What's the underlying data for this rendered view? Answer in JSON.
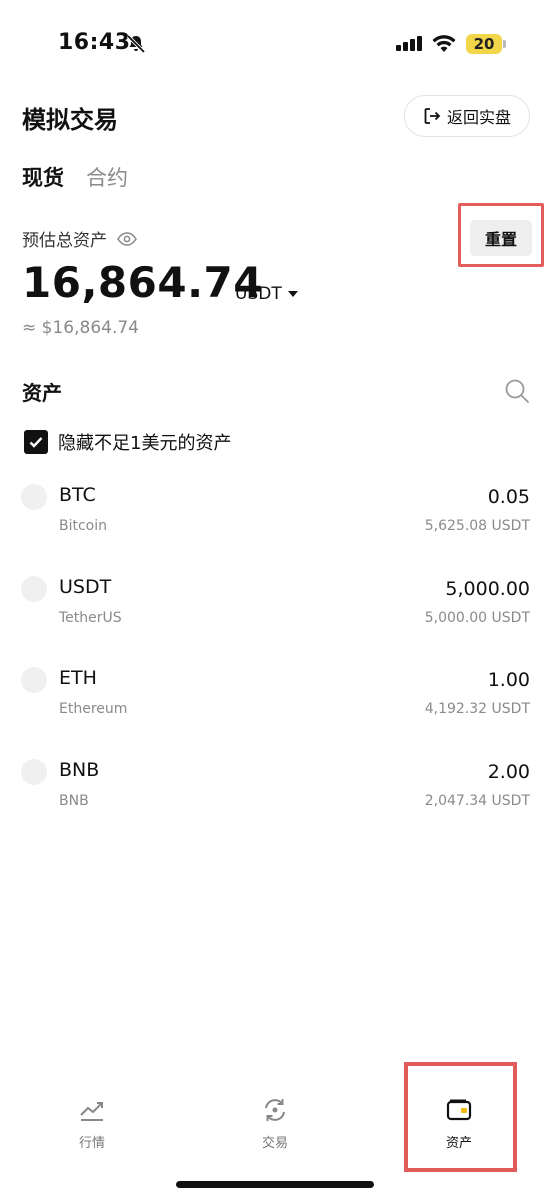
{
  "status_bar": {
    "time": "16:43",
    "battery": "20"
  },
  "header": {
    "title": "模拟交易",
    "back_button": "返回实盘"
  },
  "tabs": [
    {
      "label": "现货",
      "active": true
    },
    {
      "label": "合约",
      "active": false
    }
  ],
  "summary": {
    "label": "预估总资产",
    "reset_label": "重置",
    "total": "16,864.74",
    "unit": "USDT",
    "approx": "≈ $16,864.74"
  },
  "assets": {
    "title": "资产",
    "hide_small_label": "隐藏不足1美元的资产",
    "hide_small_checked": true,
    "items": [
      {
        "symbol": "BTC",
        "name": "Bitcoin",
        "qty": "0.05",
        "value": "5,625.08 USDT"
      },
      {
        "symbol": "USDT",
        "name": "TetherUS",
        "qty": "5,000.00",
        "value": "5,000.00 USDT"
      },
      {
        "symbol": "ETH",
        "name": "Ethereum",
        "qty": "1.00",
        "value": "4,192.32 USDT"
      },
      {
        "symbol": "BNB",
        "name": "BNB",
        "qty": "2.00",
        "value": "2,047.34 USDT"
      }
    ]
  },
  "nav": {
    "markets": "行情",
    "trade": "交易",
    "assets": "资产"
  },
  "colors": {
    "highlight": "#e35c5c",
    "accent": "#f0b90b",
    "battery": "#f1d64a"
  }
}
